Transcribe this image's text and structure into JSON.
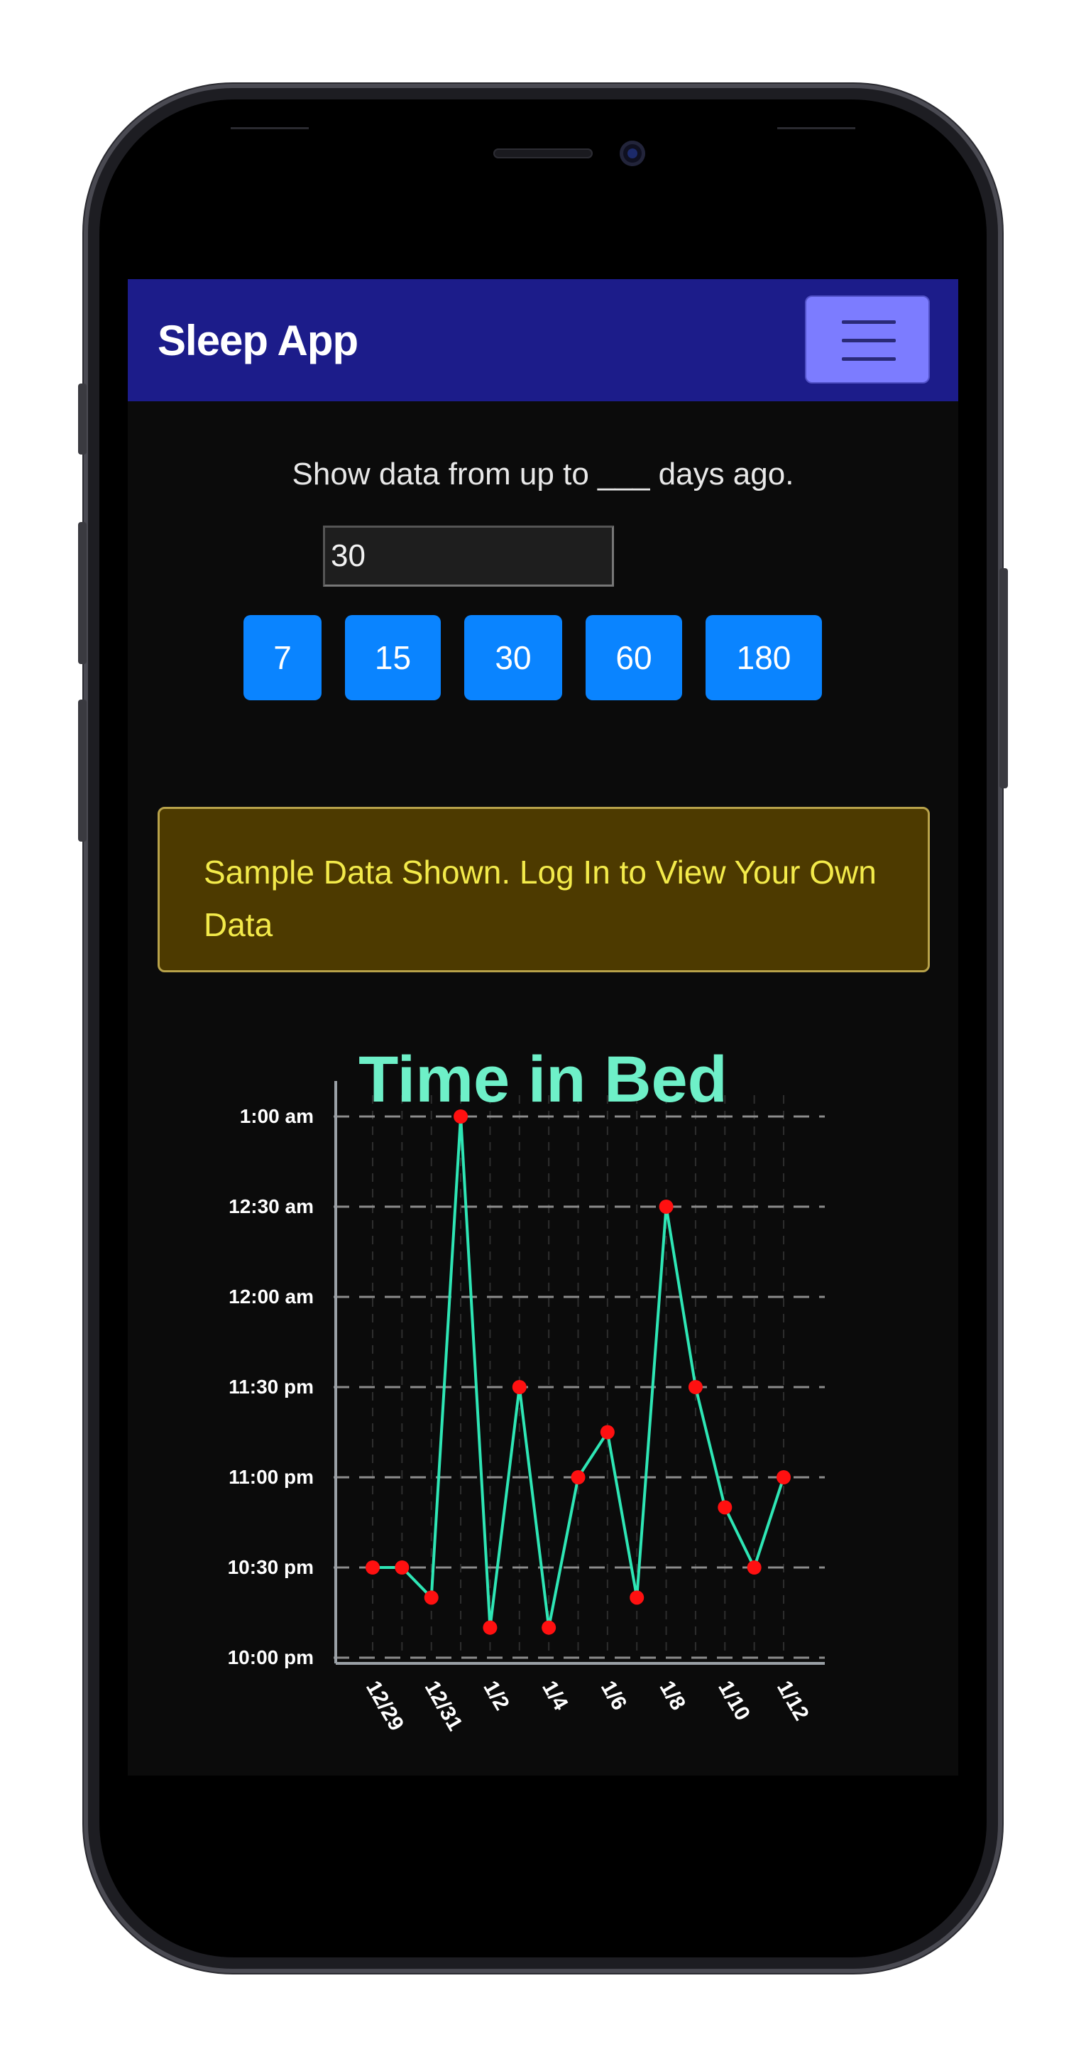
{
  "app": {
    "title": "Sleep App",
    "menu_icon": "hamburger-icon"
  },
  "filter": {
    "prompt": "Show data from up to ___ days ago.",
    "input_value": "30",
    "presets": [
      "7",
      "15",
      "30",
      "60",
      "180"
    ]
  },
  "alert": {
    "message": "Sample Data Shown. Log In to View Your Own Data"
  },
  "colors": {
    "navbar": "#1c1c8a",
    "button": "#0a84ff",
    "line": "#2ee6b5",
    "point": "#ff1010",
    "alert_text": "#f3ea4a",
    "alert_bg": "#4d3a00"
  },
  "chart_title_partial": "Time in Bed",
  "chart_data": {
    "type": "line",
    "title": "",
    "xlabel": "",
    "ylabel": "",
    "x": [
      "12/29",
      "12/30",
      "12/31",
      "1/1",
      "1/2",
      "1/3",
      "1/4",
      "1/5",
      "1/6",
      "1/7",
      "1/8",
      "1/9",
      "1/10",
      "1/11",
      "1/12"
    ],
    "x_tick_labels": [
      "12/29",
      "12/31",
      "1/2",
      "1/4",
      "1/6",
      "1/8",
      "1/10",
      "1/12"
    ],
    "y_tick_labels": [
      "10:00 pm",
      "10:30 pm",
      "11:00 pm",
      "11:30 pm",
      "12:00 am",
      "12:30 am",
      "1:00 am"
    ],
    "values": [
      "10:30 pm",
      "10:30 pm",
      "10:20 pm",
      "1:00 am",
      "10:10 pm",
      "11:30 pm",
      "10:10 pm",
      "11:00 pm",
      "11:15 pm",
      "10:20 pm",
      "12:30 am",
      "11:30 pm",
      "10:50 pm",
      "10:30 pm",
      "11:00 pm"
    ],
    "ylim": [
      "10:00 pm",
      "1:00 am"
    ],
    "grid": true,
    "legend": "none"
  }
}
